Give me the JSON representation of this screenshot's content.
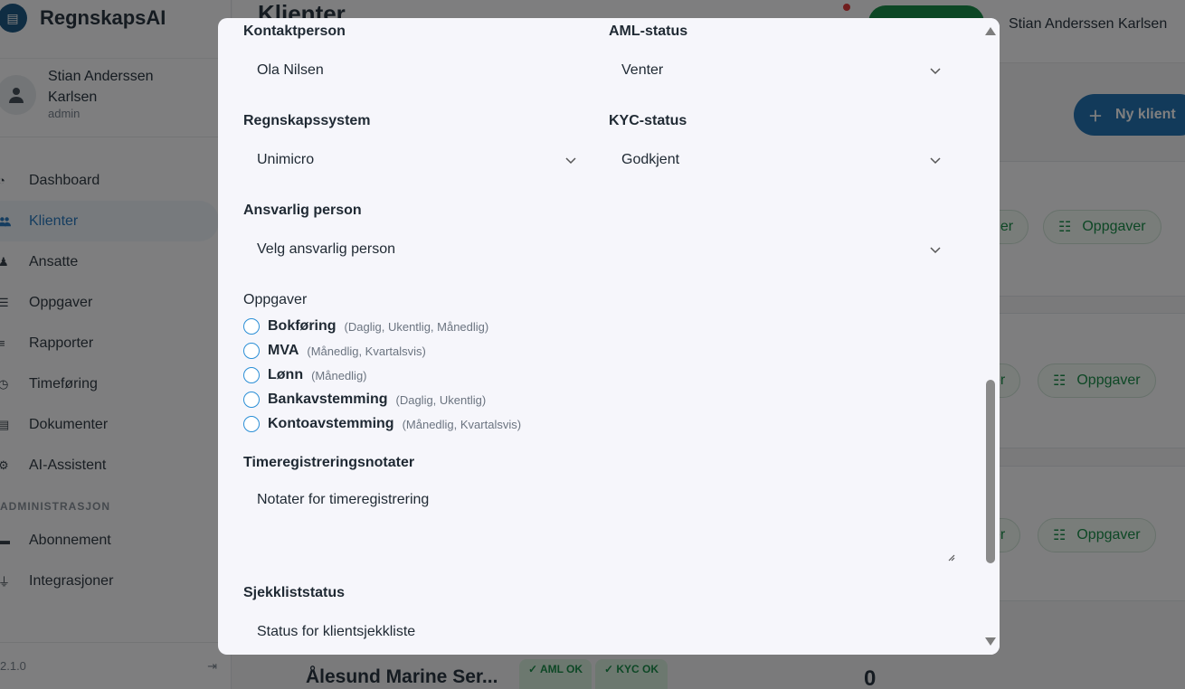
{
  "app": {
    "brand": "RegnskapsAI",
    "page_title": "Klienter",
    "header_user": "Stian Anderssen Karlsen",
    "new_client_label": "Ny klient",
    "version": "2.1.0"
  },
  "user": {
    "name": "Stian Anderssen Karlsen",
    "role": "admin"
  },
  "sidebar": {
    "items": [
      {
        "label": "Dashboard",
        "icon": "dashboard-icon",
        "glyph": "◔"
      },
      {
        "label": "Klienter",
        "icon": "users-icon",
        "glyph": "👥"
      },
      {
        "label": "Ansatte",
        "icon": "employees-icon",
        "glyph": "♟"
      },
      {
        "label": "Oppgaver",
        "icon": "tasks-icon",
        "glyph": "☰"
      },
      {
        "label": "Rapporter",
        "icon": "reports-icon",
        "glyph": "≡"
      },
      {
        "label": "Timeføring",
        "icon": "clock-icon",
        "glyph": "◷"
      },
      {
        "label": "Dokumenter",
        "icon": "documents-icon",
        "glyph": "▤"
      },
      {
        "label": "AI-Assistent",
        "icon": "robot-icon",
        "glyph": "⚙"
      }
    ],
    "admin_section": "ADMINISTRASJON",
    "admin_items": [
      {
        "label": "Abonnement",
        "icon": "card-icon",
        "glyph": "▬"
      },
      {
        "label": "Integrasjoner",
        "icon": "plug-icon",
        "glyph": "⏚"
      }
    ]
  },
  "background": {
    "pill_tasks": "Oppgaver",
    "pill_edit_fragment": "ger",
    "pill_edit_fragment2": "er",
    "last_client_name": "Ålesund Marine Ser...",
    "badge_aml": "✓ AML OK",
    "badge_kyc": "✓ KYC OK",
    "last_count": "0"
  },
  "form": {
    "contact_label": "Kontaktperson",
    "contact_value": "Ola Nilsen",
    "aml_label": "AML-status",
    "aml_value": "Venter",
    "system_label": "Regnskapssystem",
    "system_value": "Unimicro",
    "kyc_label": "KYC-status",
    "kyc_value": "Godkjent",
    "responsible_label": "Ansvarlig person",
    "responsible_value": "Velg ansvarlig person",
    "tasks_label": "Oppgaver",
    "tasks": [
      {
        "name": "Bokføring",
        "freq": "(Daglig, Ukentlig, Månedlig)"
      },
      {
        "name": "MVA",
        "freq": "(Månedlig, Kvartalsvis)"
      },
      {
        "name": "Lønn",
        "freq": "(Månedlig)"
      },
      {
        "name": "Bankavstemming",
        "freq": "(Daglig, Ukentlig)"
      },
      {
        "name": "Kontoavstemming",
        "freq": "(Månedlig, Kvartalsvis)"
      }
    ],
    "notes_label": "Timeregistreringsnotater",
    "notes_placeholder": "Notater for timeregistrering",
    "checklist_label": "Sjekkliststatus",
    "checklist_placeholder": "Status for klientsjekkliste"
  }
}
